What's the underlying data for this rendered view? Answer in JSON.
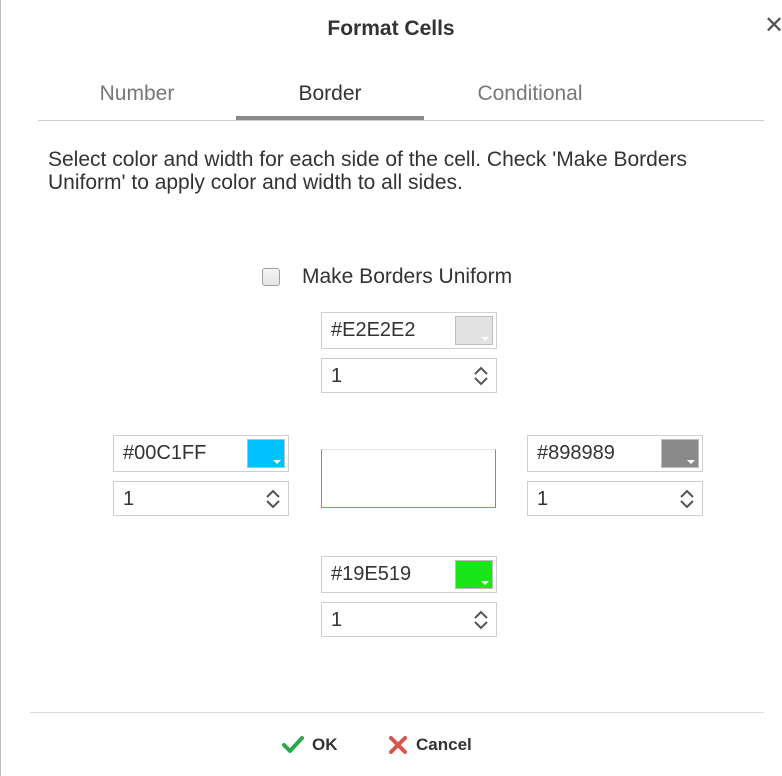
{
  "dialog": {
    "title": "Format Cells"
  },
  "tabs": [
    {
      "label": "Number"
    },
    {
      "label": "Border"
    },
    {
      "label": "Conditional"
    }
  ],
  "active_tab": "Border",
  "description": "Select color and width for each side of the cell. Check 'Make Borders Uniform' to apply color and width to all sides.",
  "uniform": {
    "label": "Make Borders Uniform",
    "checked": false
  },
  "borders": {
    "top": {
      "color": "#E2E2E2",
      "width": "1"
    },
    "left": {
      "color": "#00C1FF",
      "width": "1"
    },
    "right": {
      "color": "#898989",
      "width": "1"
    },
    "bottom": {
      "color": "#19E519",
      "width": "1"
    }
  },
  "buttons": {
    "ok": "OK",
    "cancel": "Cancel"
  },
  "icons": {
    "close": "close-icon",
    "ok": "checkmark-icon",
    "cancel": "x-icon",
    "spin": "spin-updown-icon",
    "dropdown": "dropdown-arrow-icon"
  },
  "colors": {
    "ok_icon": "#2BA84A",
    "cancel_icon": "#D9534F",
    "active_tab_underline": "#8a8a8a"
  }
}
